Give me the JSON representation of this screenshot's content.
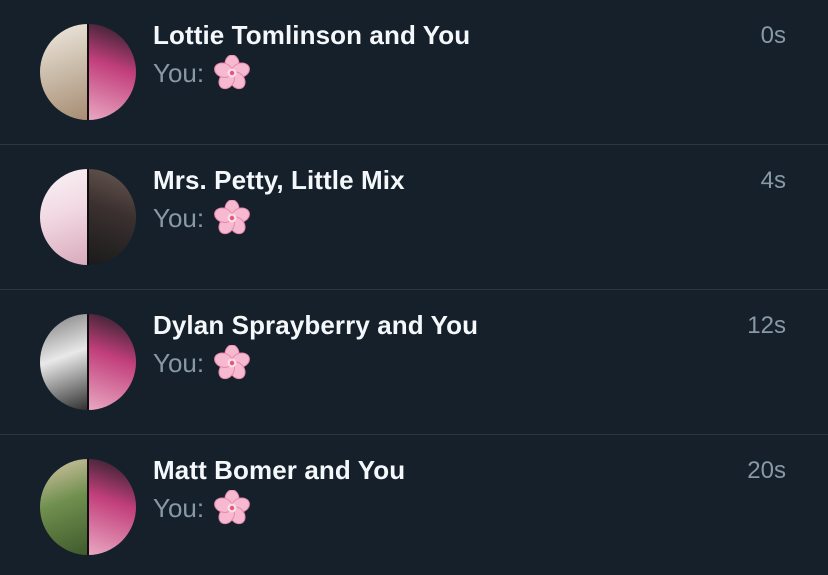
{
  "conversations": [
    {
      "title": "Lottie Tomlinson and You",
      "time": "0s",
      "preview_sender": "You:",
      "preview_content": "cherry-blossom-emoji",
      "avatar": {
        "left_name": "blonde-woman-photo",
        "right_name": "pink-glasses-man-photo",
        "left_colors": [
          "#cdbfae",
          "#f1ebe2",
          "#a78c72"
        ],
        "right_colors": [
          "#e9a8c2",
          "#c23f7c",
          "#1d1d22"
        ]
      }
    },
    {
      "title": "Mrs. Petty, Little Mix",
      "time": "4s",
      "preview_sender": "You:",
      "preview_content": "cherry-blossom-emoji",
      "avatar": {
        "left_name": "pink-room-photo",
        "right_name": "group-in-black-photo",
        "left_colors": [
          "#f2d9e3",
          "#f9f4f6",
          "#d8aabc"
        ],
        "right_colors": [
          "#1a1a1a",
          "#3b3030",
          "#6a5a52"
        ]
      }
    },
    {
      "title": "Dylan Sprayberry and You",
      "time": "12s",
      "preview_sender": "You:",
      "preview_content": "cherry-blossom-emoji",
      "avatar": {
        "left_name": "black-and-white-photo",
        "right_name": "pink-glasses-man-photo",
        "left_colors": [
          "#e9e9e9",
          "#7a7a7a",
          "#2e2e2e"
        ],
        "right_colors": [
          "#e9a8c2",
          "#c23f7c",
          "#1d1d22"
        ]
      }
    },
    {
      "title": "Matt Bomer and You",
      "time": "20s",
      "preview_sender": "You:",
      "preview_content": "cherry-blossom-emoji",
      "avatar": {
        "left_name": "two-people-sunglasses-photo",
        "right_name": "pink-glasses-man-photo",
        "left_colors": [
          "#6f8f4e",
          "#d9c7a8",
          "#3f5a2c"
        ],
        "right_colors": [
          "#e9a8c2",
          "#c23f7c",
          "#1d1d22"
        ]
      }
    }
  ],
  "theme": {
    "background": "#15202b",
    "divider": "#2b3640",
    "title_color": "#f5f8fa",
    "secondary_text": "#8899a6"
  }
}
